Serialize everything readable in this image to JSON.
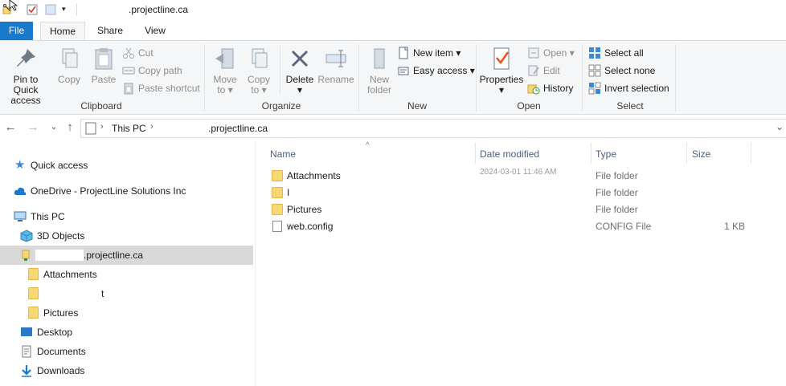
{
  "titlebar": {
    "title": ".projectline.ca"
  },
  "tabs": {
    "file": "File",
    "home": "Home",
    "share": "Share",
    "view": "View"
  },
  "ribbon": {
    "clipboard": {
      "label": "Clipboard",
      "pin_line1": "Pin to Quick",
      "pin_line2": "access",
      "copy": "Copy",
      "paste": "Paste",
      "cut": "Cut",
      "copy_path": "Copy path",
      "paste_shortcut": "Paste shortcut"
    },
    "organize": {
      "label": "Organize",
      "move_line1": "Move",
      "move_line2": "to",
      "copy_line1": "Copy",
      "copy_line2": "to",
      "delete": "Delete",
      "rename": "Rename"
    },
    "new": {
      "label": "New",
      "new_folder_line1": "New",
      "new_folder_line2": "folder",
      "new_item": "New item",
      "easy_access": "Easy access"
    },
    "open": {
      "label": "Open",
      "properties": "Properties",
      "open": "Open",
      "edit": "Edit",
      "history": "History"
    },
    "select": {
      "label": "Select",
      "select_all": "Select all",
      "select_none": "Select none",
      "invert_selection": "Invert selection"
    }
  },
  "address": {
    "crumb1": "This PC",
    "crumb2": ".projectline.ca"
  },
  "nav": {
    "quick_access": "Quick access",
    "onedrive": "OneDrive - ProjectLine Solutions Inc",
    "this_pc": "This PC",
    "objects3d": "3D Objects",
    "site": ".projectline.ca",
    "attachments": "Attachments",
    "redacted_folder": "t",
    "pictures": "Pictures",
    "desktop": "Desktop",
    "documents": "Documents",
    "downloads": "Downloads"
  },
  "list": {
    "columns": {
      "name": "Name",
      "date": "Date modified",
      "type": "Type",
      "size": "Size"
    },
    "rows": [
      {
        "name": "Attachments",
        "date": "2024-03-01 11:46 AM",
        "type": "File folder",
        "size": ""
      },
      {
        "name": "I",
        "date": "",
        "type": "File folder",
        "size": ""
      },
      {
        "name": "Pictures",
        "date": "",
        "type": "File folder",
        "size": ""
      },
      {
        "name": "web.config",
        "date": "",
        "type": "CONFIG File",
        "size": "1 KB"
      }
    ]
  },
  "colors": {
    "accent": "#1979ca",
    "selection": "#d9d9d9",
    "folder": "#f8d775"
  }
}
